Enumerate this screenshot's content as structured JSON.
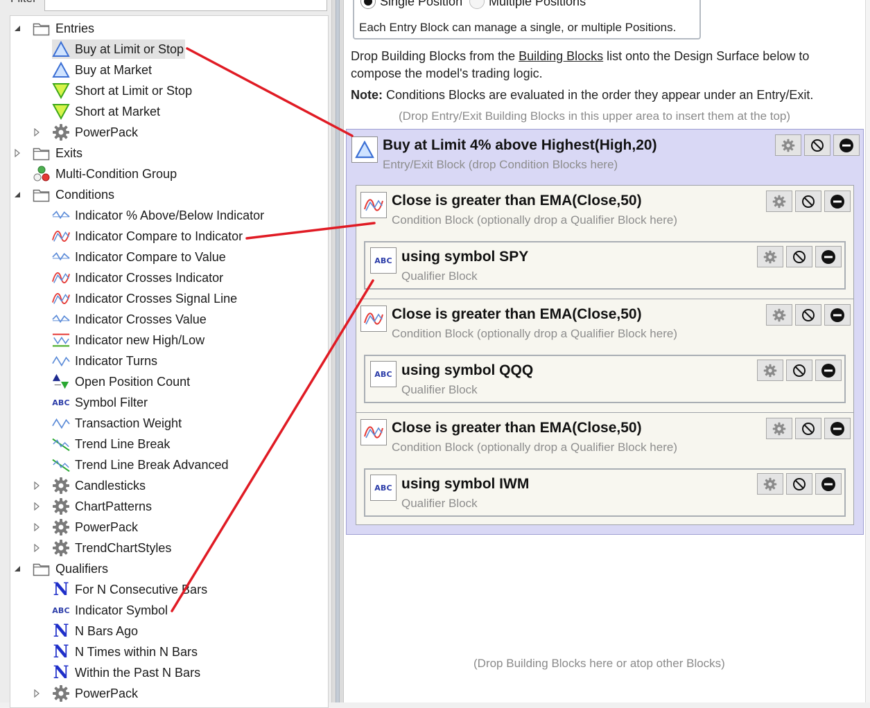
{
  "filter": {
    "label": "Filter",
    "value": ""
  },
  "tree": [
    {
      "label": "Entries",
      "icon": "folder-icon",
      "expander": "expanded",
      "level": 0,
      "slug": "entries"
    },
    {
      "label": "Buy at Limit or Stop",
      "icon": "buy-triangle-icon",
      "level": 1,
      "selected": true,
      "slug": "buy-at-limit-or-stop"
    },
    {
      "label": "Buy at Market",
      "icon": "buy-triangle-icon",
      "level": 1,
      "slug": "buy-at-market"
    },
    {
      "label": "Short at Limit or Stop",
      "icon": "short-triangle-icon",
      "level": 1,
      "slug": "short-at-limit-or-stop"
    },
    {
      "label": "Short at Market",
      "icon": "short-triangle-icon",
      "level": 1,
      "slug": "short-at-market"
    },
    {
      "label": "PowerPack",
      "icon": "gear-icon",
      "expander": "collapsed",
      "level": 1,
      "slug": "entries-powerpack"
    },
    {
      "label": "Exits",
      "icon": "folder-icon",
      "expander": "collapsed",
      "level": 0,
      "slug": "exits"
    },
    {
      "label": "Multi-Condition Group",
      "icon": "multi-condition-icon",
      "level": 0,
      "slug": "multi-condition-group"
    },
    {
      "label": "Conditions",
      "icon": "folder-icon",
      "expander": "expanded",
      "level": 0,
      "slug": "conditions"
    },
    {
      "label": "Indicator % Above/Below Indicator",
      "icon": "indicator-blue-wave-icon",
      "level": 1,
      "slug": "indicator-pct-above-below"
    },
    {
      "label": "Indicator Compare to Indicator",
      "icon": "indicator-compare-icon",
      "level": 1,
      "slug": "indicator-compare-to-indicator"
    },
    {
      "label": "Indicator Compare to Value",
      "icon": "indicator-blue-wave-icon",
      "level": 1,
      "slug": "indicator-compare-to-value"
    },
    {
      "label": "Indicator Crosses Indicator",
      "icon": "indicator-compare-icon",
      "level": 1,
      "slug": "indicator-crosses-indicator"
    },
    {
      "label": "Indicator Crosses Signal Line",
      "icon": "indicator-compare-icon",
      "level": 1,
      "slug": "indicator-crosses-signal-line"
    },
    {
      "label": "Indicator Crosses Value",
      "icon": "indicator-blue-wave-icon",
      "level": 1,
      "slug": "indicator-crosses-value"
    },
    {
      "label": "Indicator new High/Low",
      "icon": "indicator-high-low-icon",
      "level": 1,
      "slug": "indicator-new-high-low"
    },
    {
      "label": "Indicator Turns",
      "icon": "indicator-turns-icon",
      "level": 1,
      "slug": "indicator-turns"
    },
    {
      "label": "Open Position Count",
      "icon": "position-count-icon",
      "level": 1,
      "slug": "open-position-count"
    },
    {
      "label": "Symbol Filter",
      "icon": "abc-icon",
      "level": 1,
      "slug": "symbol-filter"
    },
    {
      "label": "Transaction Weight",
      "icon": "indicator-turns-icon",
      "level": 1,
      "slug": "transaction-weight"
    },
    {
      "label": "Trend Line Break",
      "icon": "trend-line-icon",
      "level": 1,
      "slug": "trend-line-break"
    },
    {
      "label": "Trend Line Break Advanced",
      "icon": "trend-line-icon",
      "level": 1,
      "slug": "trend-line-break-advanced"
    },
    {
      "label": "Candlesticks",
      "icon": "gear-icon",
      "expander": "collapsed",
      "level": 1,
      "slug": "candlesticks"
    },
    {
      "label": "ChartPatterns",
      "icon": "gear-icon",
      "expander": "collapsed",
      "level": 1,
      "slug": "chartpatterns"
    },
    {
      "label": "PowerPack",
      "icon": "gear-icon",
      "expander": "collapsed",
      "level": 1,
      "slug": "conditions-powerpack"
    },
    {
      "label": "TrendChartStyles",
      "icon": "gear-icon",
      "expander": "collapsed",
      "level": 1,
      "slug": "trendchartstyles"
    },
    {
      "label": "Qualifiers",
      "icon": "folder-icon",
      "expander": "expanded",
      "level": 0,
      "slug": "qualifiers"
    },
    {
      "label": "For N Consecutive Bars",
      "icon": "n-icon",
      "level": 1,
      "slug": "for-n-consecutive-bars"
    },
    {
      "label": "Indicator Symbol",
      "icon": "abc-icon",
      "level": 1,
      "slug": "indicator-symbol"
    },
    {
      "label": "N Bars Ago",
      "icon": "n-icon",
      "level": 1,
      "slug": "n-bars-ago"
    },
    {
      "label": "N Times within N Bars",
      "icon": "n-icon",
      "level": 1,
      "slug": "n-times-within-n-bars"
    },
    {
      "label": "Within the Past N Bars",
      "icon": "n-icon",
      "level": 1,
      "slug": "within-the-past-n-bars"
    },
    {
      "label": "PowerPack",
      "icon": "gear-icon",
      "expander": "collapsed",
      "level": 1,
      "slug": "qualifiers-powerpack"
    }
  ],
  "positions": {
    "single_label": "Single Position",
    "multiple_label": "Multiple Positions",
    "selected": "single",
    "description": "Each Entry Block can manage a single, or multiple Positions."
  },
  "instructions": {
    "line1_pre": "Drop Building Blocks from the ",
    "line1_link": "Building Blocks",
    "line1_post": " list onto the Design Surface below to",
    "line2": "compose the model's trading logic.",
    "note_label": "Note:",
    "note_text": " Conditions Blocks are evaluated in the order they appear under an Entry/Exit.",
    "top_drop_hint": "(Drop Entry/Exit Building Blocks in this upper area to insert them at the top)",
    "bottom_drop_hint": "(Drop Building Blocks here or atop other Blocks)"
  },
  "entry_block": {
    "title": "Buy at Limit 4% above Highest(High,20)",
    "subtitle": "Entry/Exit Block (drop Condition Blocks here)",
    "icon": "buy-triangle-icon"
  },
  "conditions": [
    {
      "title": "Close is greater than EMA(Close,50)",
      "subtitle": "Condition Block (optionally drop a Qualifier Block here)",
      "qualifier": {
        "title": "using symbol SPY",
        "subtitle": "Qualifier Block",
        "icon_text": "ABC"
      }
    },
    {
      "title": "Close is greater than EMA(Close,50)",
      "subtitle": "Condition Block (optionally drop a Qualifier Block here)",
      "qualifier": {
        "title": "using symbol QQQ",
        "subtitle": "Qualifier Block",
        "icon_text": "ABC"
      }
    },
    {
      "title": "Close is greater than EMA(Close,50)",
      "subtitle": "Condition Block (optionally drop a Qualifier Block here)",
      "qualifier": {
        "title": "using symbol IWM",
        "subtitle": "Qualifier Block",
        "icon_text": "ABC"
      }
    }
  ],
  "block_buttons": [
    "settings-gear-icon",
    "disable-icon",
    "remove-icon"
  ],
  "colors": {
    "entry_block_bg": "#d9d8f5",
    "condition_block_bg": "#f7f6ef",
    "annotation_line": "#e01b24",
    "buy_triangle": "#3b6fd4",
    "short_triangle": "#6ccf1f"
  }
}
